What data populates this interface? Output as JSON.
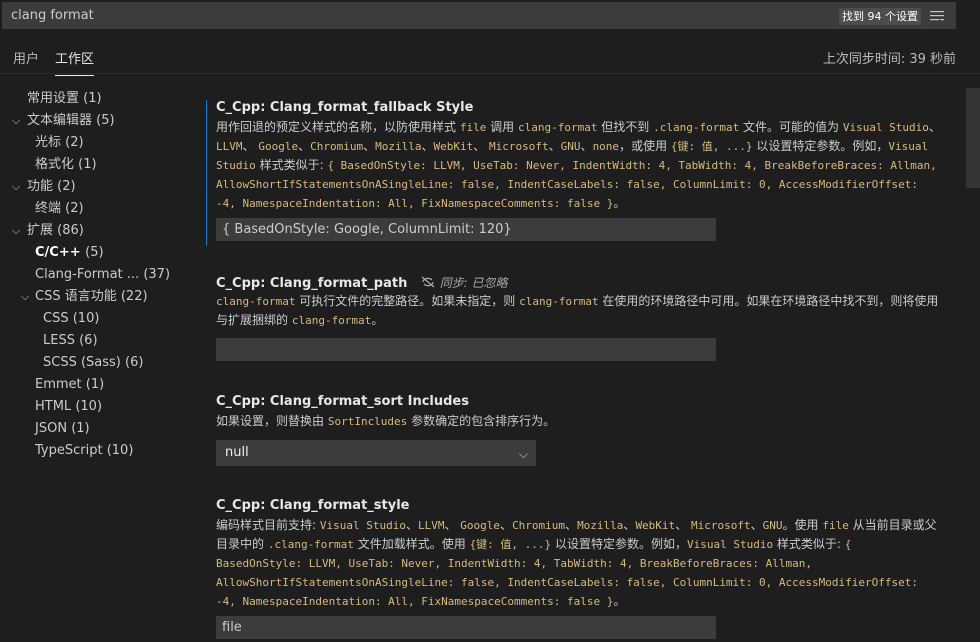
{
  "search": {
    "query": "clang format",
    "result_count_label": "找到 94 个设置",
    "filter_icon": "filter-list-icon"
  },
  "tabs": [
    {
      "label": "用户"
    },
    {
      "label": "工作区"
    }
  ],
  "sync_status": "上次同步时间: 39 秒前",
  "toc": [
    {
      "label": "常用设置",
      "count": "(1)",
      "level": 1,
      "expanded": null
    },
    {
      "label": "文本编辑器",
      "count": "(5)",
      "level": 0,
      "expanded": true
    },
    {
      "label": "光标",
      "count": "(2)",
      "level": 2,
      "expanded": null
    },
    {
      "label": "格式化",
      "count": "(1)",
      "level": 2,
      "expanded": null
    },
    {
      "label": "功能",
      "count": "(2)",
      "level": 0,
      "expanded": true
    },
    {
      "label": "终端",
      "count": "(2)",
      "level": 2,
      "expanded": null
    },
    {
      "label": "扩展",
      "count": "(86)",
      "level": 0,
      "expanded": true
    },
    {
      "label": "C/C++",
      "count": "(5)",
      "level": 2,
      "expanded": null,
      "active": true
    },
    {
      "label": "Clang-Format ...",
      "count": "(37)",
      "level": 2,
      "expanded": null
    },
    {
      "label": "CSS 语言功能",
      "count": "(22)",
      "level": 1,
      "expanded": true
    },
    {
      "label": "CSS",
      "count": "(10)",
      "level": 3,
      "expanded": null
    },
    {
      "label": "LESS",
      "count": "(6)",
      "level": 3,
      "expanded": null
    },
    {
      "label": "SCSS (Sass)",
      "count": "(6)",
      "level": 3,
      "expanded": null
    },
    {
      "label": "Emmet",
      "count": "(1)",
      "level": 2,
      "expanded": null
    },
    {
      "label": "HTML",
      "count": "(10)",
      "level": 2,
      "expanded": null
    },
    {
      "label": "JSON",
      "count": "(1)",
      "level": 2,
      "expanded": null
    },
    {
      "label": "TypeScript",
      "count": "(10)",
      "level": 2,
      "expanded": null
    }
  ],
  "settings": {
    "fallback": {
      "category": "C_Cpp: ",
      "name": "Clang_format_fallback Style",
      "desc_html": "用作回退的预定义样式的名称，以防使用样式 <code>file</code> 调用 <code>clang-format</code> 但找不到 <code>.clang-format</code> 文件。可能的值为 <code>Visual Studio</code>、<code>LLVM</code>、 <code>Google</code>、<code>Chromium</code>、<code>Mozilla</code>、<code>WebKit</code>、 <code>Microsoft</code>、<code>GNU</code>、<code>none</code>，或使用 <code>{键: 值, ...}</code> 以设置特定参数。例如，<code>Visual Studio</code> 样式类似于: <code>{ BasedOnStyle: LLVM, UseTab: Never, IndentWidth: 4, TabWidth: 4, BreakBeforeBraces: Allman, AllowShortIfStatementsOnASingleLine: false, IndentCaseLabels: false, ColumnLimit: 0, AccessModifierOffset: -4, NamespaceIndentation: All, FixNamespaceComments: false }</code>。",
      "value": "{ BasedOnStyle: Google, ColumnLimit: 120}"
    },
    "path": {
      "category": "C_Cpp: ",
      "name": "Clang_format_path",
      "ignored_label": "同步: 已忽略",
      "desc_html": "<code>clang-format</code> 可执行文件的完整路径。如果未指定，则 <code>clang-format</code> 在使用的环境路径中可用。如果在环境路径中找不到，则将使用与扩展捆绑的 <code>clang-format</code>。",
      "value": ""
    },
    "sort": {
      "category": "C_Cpp: ",
      "name": "Clang_format_sort Includes",
      "desc_html": "如果设置，则替换由 <code>SortIncludes</code> 参数确定的包含排序行为。",
      "value": "null"
    },
    "style": {
      "category": "C_Cpp: ",
      "name": "Clang_format_style",
      "desc_html": "编码样式目前支持: <code>Visual Studio</code>、<code>LLVM</code>、 <code>Google</code>、<code>Chromium</code>、<code>Mozilla</code>、<code>WebKit</code>、 <code>Microsoft</code>、<code>GNU</code>。使用 <code>file</code> 从当前目录或父目录中的 <code>.clang-format</code> 文件加载样式。使用 <code>{键: 值, ...}</code> 以设置特定参数。例如，<code>Visual Studio</code> 样式类似于: <code>{ BasedOnStyle: LLVM, UseTab: Never, IndentWidth: 4, TabWidth: 4, BreakBeforeBraces: Allman, AllowShortIfStatementsOnASingleLine: false, IndentCaseLabels: false, ColumnLimit: 0, AccessModifierOffset: -4, NamespaceIndentation: All, FixNamespaceComments: false }</code>。",
      "value": "file"
    }
  },
  "colors": {
    "background": "#1e1e1e",
    "input_background": "#3c3c3c",
    "focus_border": "#007fd4",
    "code_text": "#d7ba7d"
  }
}
